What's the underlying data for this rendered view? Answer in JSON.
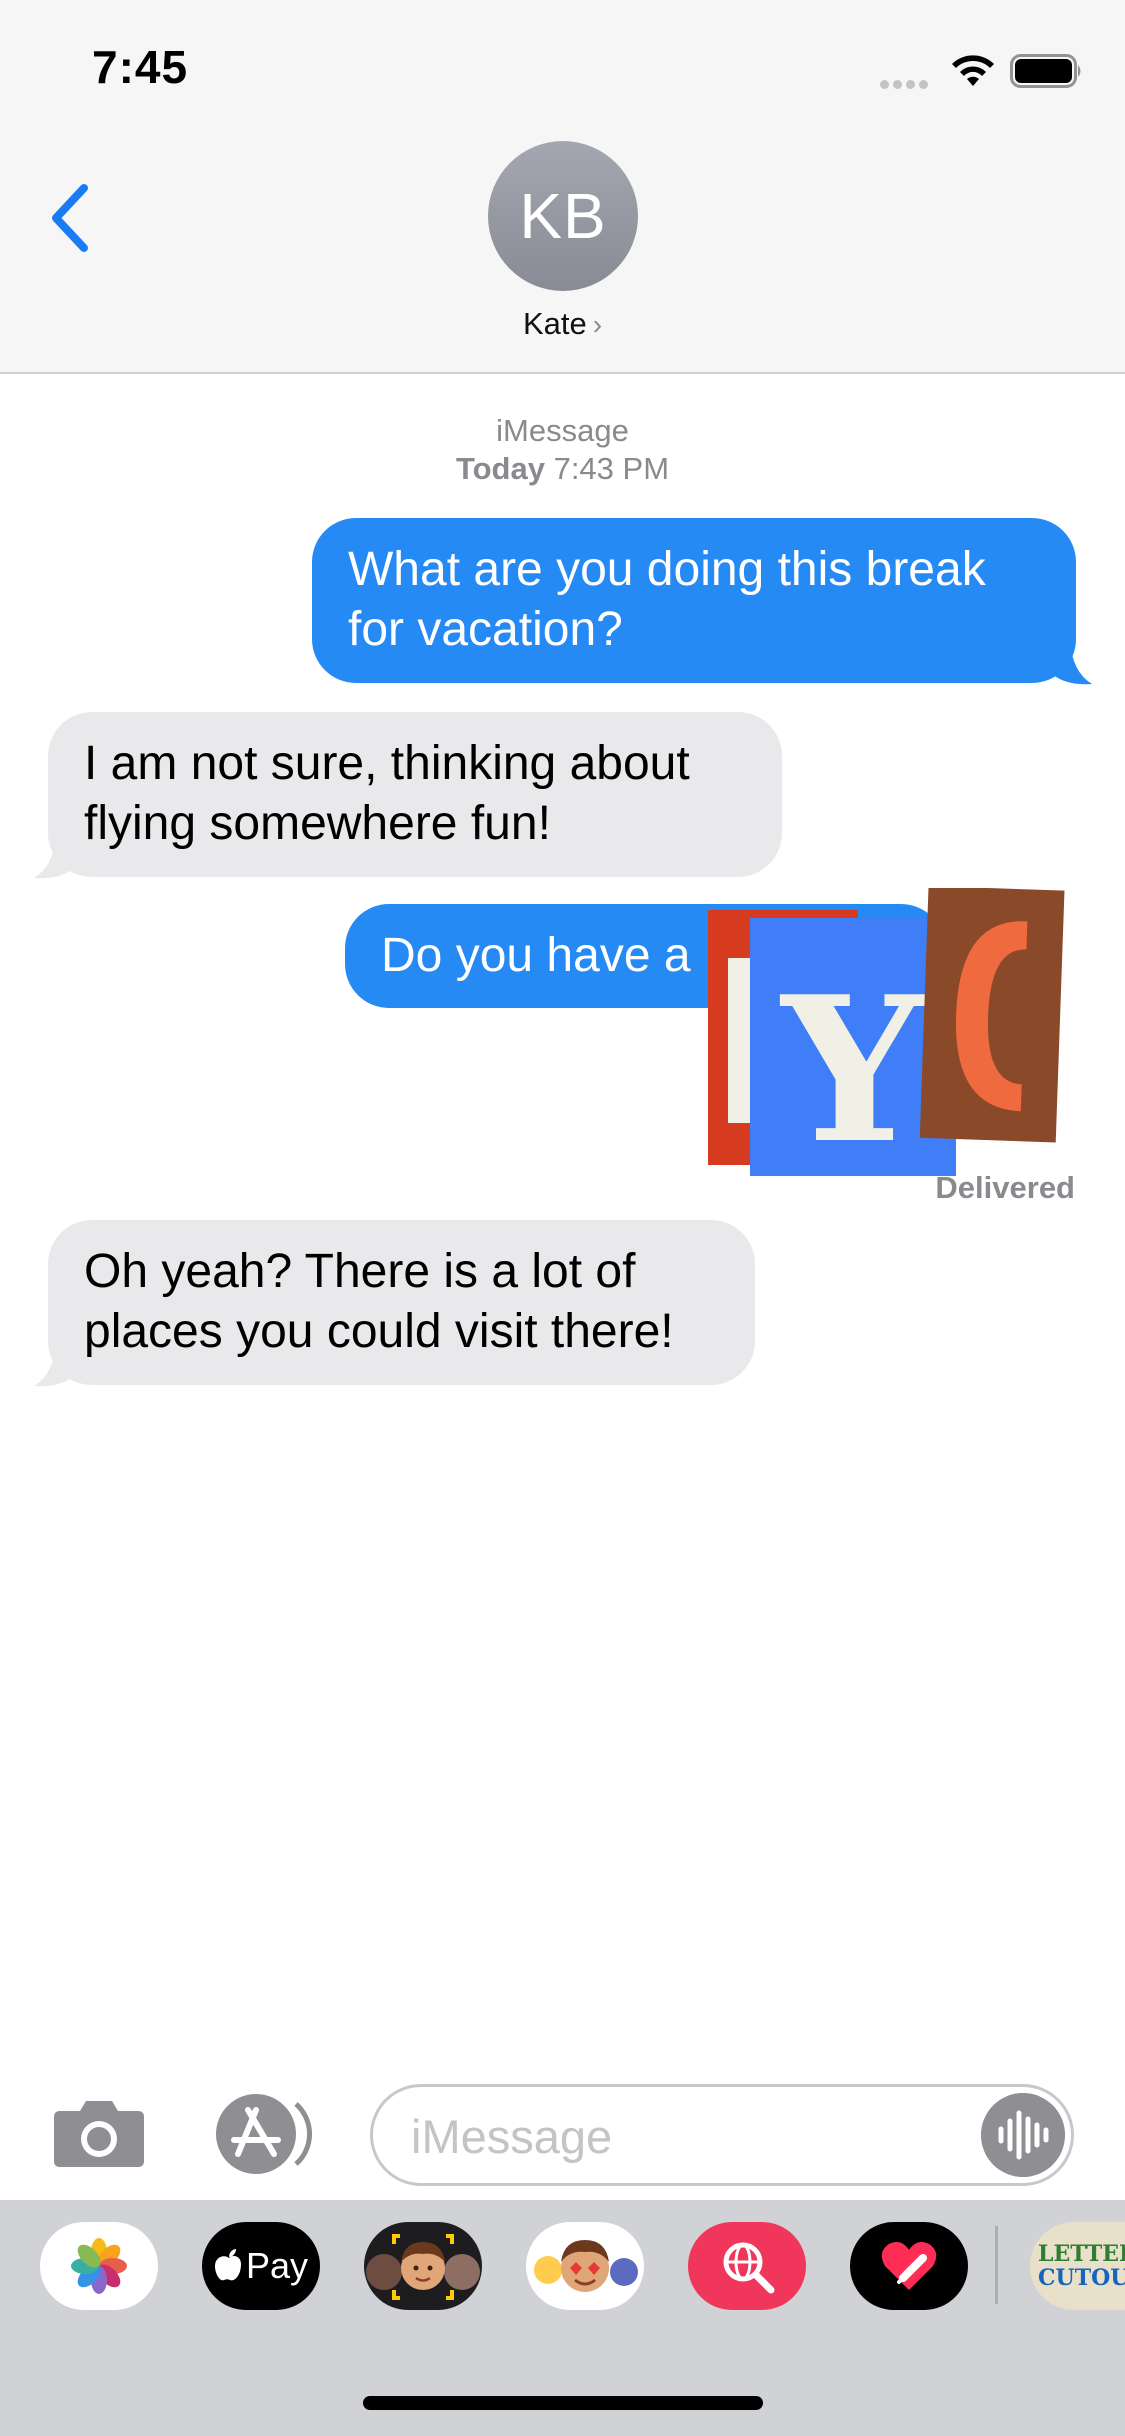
{
  "status_bar": {
    "time": "7:45"
  },
  "header": {
    "avatar_initials": "KB",
    "contact_name": "Kate",
    "contact_chevron": "›"
  },
  "thread_meta": {
    "service": "iMessage",
    "day": "Today",
    "time": "7:43 PM"
  },
  "messages": [
    {
      "direction": "outgoing",
      "line1": "What are you doing this break",
      "line2": "for vacation?"
    },
    {
      "direction": "incoming",
      "line1": "I am not sure, thinking about",
      "line2": "flying somewhere fun!"
    },
    {
      "direction": "outgoing",
      "text": "Do you have a"
    },
    {
      "direction": "incoming",
      "line1": "Oh yeah? There is a lot of",
      "line2": "places you could visit there!"
    }
  ],
  "sticker": {
    "letters": [
      "Y",
      "C"
    ],
    "colors": [
      "#d63b1f",
      "#3f7ef6",
      "#8a4a2a",
      "#f0f0e6"
    ]
  },
  "delivery_status": "Delivered",
  "composer": {
    "placeholder": "iMessage"
  },
  "app_drawer": {
    "apple_pay_label": "Pay",
    "cutout_label_1": "LETTER",
    "cutout_label_2": "CUTOUT",
    "icons": [
      "photos-icon",
      "apple-pay-icon",
      "memoji-icon",
      "animoji-icon",
      "image-search-icon",
      "digital-touch-icon",
      "letter-cutouts-icon"
    ]
  },
  "colors": {
    "accent": "#268af4",
    "incoming": "#e9e9eb",
    "link_blue": "#1a7cf5"
  }
}
